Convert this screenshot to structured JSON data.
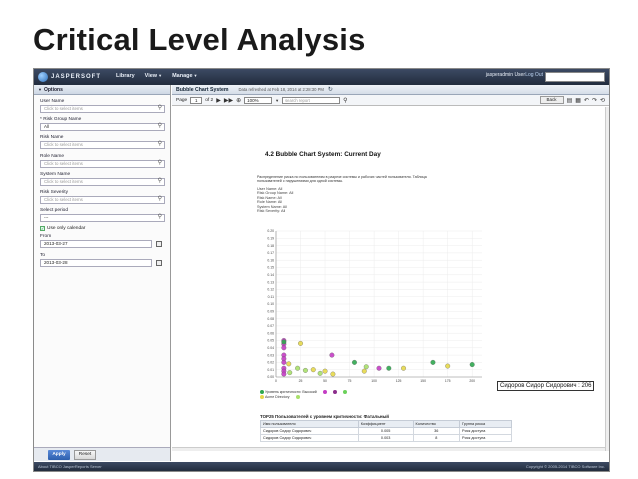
{
  "slide": {
    "title": "Critical Level Analysis"
  },
  "topbar": {
    "logo_text": "JASPERSOFT",
    "menu": [
      "Library",
      "View",
      "Manage"
    ],
    "user": "jasperadmin User",
    "logout": "Log Out"
  },
  "left_panel": {
    "header": "Options",
    "fields": [
      {
        "label": "User Name",
        "placeholder": "Click to select items"
      },
      {
        "label": "* Risk Group Name",
        "value": "All"
      },
      {
        "label": "Risk Name",
        "placeholder": "Click to select items"
      },
      {
        "label": "Role Name",
        "placeholder": "Click to select items"
      },
      {
        "label": "System Name",
        "placeholder": "Click to select items"
      },
      {
        "label": "Risk Severity",
        "placeholder": "Click to select items"
      }
    ],
    "period": {
      "label": "Select period",
      "value": "---"
    },
    "use_calendar": "Use only calendar",
    "from": {
      "label": "From",
      "value": "2013-03-27"
    },
    "to": {
      "label": "To",
      "value": "2013-03-28"
    },
    "apply": "Apply",
    "reset": "Reset"
  },
  "main": {
    "tab_title": "Bubble Chart System",
    "tab_meta": "Data refreshed at Feb 18, 2014 at 2:28:30 PM",
    "toolbar": {
      "page_label": "Page",
      "page_value": "1",
      "of_label": "of 2",
      "zoom": "100%",
      "search_placeholder": "search report",
      "back": "Back"
    },
    "report": {
      "title": "4.2 Bubble Chart System: Current Day",
      "description": "Распределение риска по пользователям в разрезе системы и рабочих частей пользователя. Таблица пользователей с нарушениями для одной системы.",
      "params": [
        "User Name: All",
        "Risk Group Name: All",
        "Risk Name: All",
        "Role Name: All",
        "System Name: All",
        "Risk Severity: All"
      ]
    },
    "tooltip": "Сидоров Сидор Сидорович : 206",
    "legend": [
      {
        "label": "Уровень критичности: Высокий",
        "color": "#2fa84f"
      },
      {
        "label": "",
        "color": "#c43dc4"
      },
      {
        "label": "",
        "color": "#8c2d8c"
      },
      {
        "label": "",
        "color": "#6bd15a"
      },
      {
        "label": "Acme Directory",
        "color": "#e6d84a"
      },
      {
        "label": "",
        "color": "#a9e06a"
      }
    ],
    "table": {
      "title": "TOP25 Пользователей с уровнем критичности: Фатальный",
      "headers": [
        "Имя пользователя",
        "Коэффициент",
        "Количество",
        "Группа риска"
      ],
      "rows": [
        [
          "Сидоров Сидор Сидорович",
          "0.005",
          "36",
          "Риск доступа"
        ],
        [
          "Сидоров Сидор Сидорович",
          "0.003",
          "8",
          "Риск доступа"
        ]
      ]
    },
    "statusbar_left": "About TIBCO JasperReports Server",
    "statusbar_right": "Copyright © 2005-2014 TIBCO Software Inc."
  },
  "chart_data": {
    "type": "scatter",
    "title": "",
    "xlabel": "",
    "ylabel": "",
    "xlim": [
      0,
      210
    ],
    "ylim": [
      0,
      0.2
    ],
    "x_ticks": [
      "0",
      "25",
      "50",
      "75",
      "100",
      "125",
      "150",
      "175",
      "200"
    ],
    "y_ticks": [
      "0.00",
      "0.01",
      "0.02",
      "0.03",
      "0.04",
      "0.05",
      "0.06",
      "0.07",
      "0.08",
      "0.09",
      "0.10",
      "0.11",
      "0.12",
      "0.13",
      "0.14",
      "0.15",
      "0.16",
      "0.17",
      "0.18",
      "0.19",
      "0.20"
    ],
    "grid": true,
    "series": [
      {
        "color": "#c43dc4",
        "points": [
          [
            8,
            0.05
          ],
          [
            8,
            0.045
          ],
          [
            8,
            0.04
          ],
          [
            8,
            0.03
          ],
          [
            8,
            0.025
          ],
          [
            8,
            0.02
          ],
          [
            8,
            0.012
          ],
          [
            8,
            0.008
          ],
          [
            8,
            0.004
          ],
          [
            57,
            0.03
          ],
          [
            105,
            0.012
          ]
        ]
      },
      {
        "color": "#2fa84f",
        "points": [
          [
            8,
            0.048
          ],
          [
            80,
            0.02
          ],
          [
            160,
            0.02
          ],
          [
            115,
            0.012
          ],
          [
            200,
            0.017
          ]
        ]
      },
      {
        "color": "#e6d84a",
        "points": [
          [
            25,
            0.046
          ],
          [
            13,
            0.018
          ],
          [
            38,
            0.01
          ],
          [
            50,
            0.008
          ],
          [
            90,
            0.008
          ],
          [
            175,
            0.015
          ],
          [
            58,
            0.004
          ],
          [
            130,
            0.012
          ]
        ]
      },
      {
        "color": "#a9e06a",
        "points": [
          [
            22,
            0.012
          ],
          [
            30,
            0.009
          ],
          [
            14,
            0.006
          ],
          [
            92,
            0.014
          ],
          [
            45,
            0.005
          ]
        ]
      }
    ]
  }
}
